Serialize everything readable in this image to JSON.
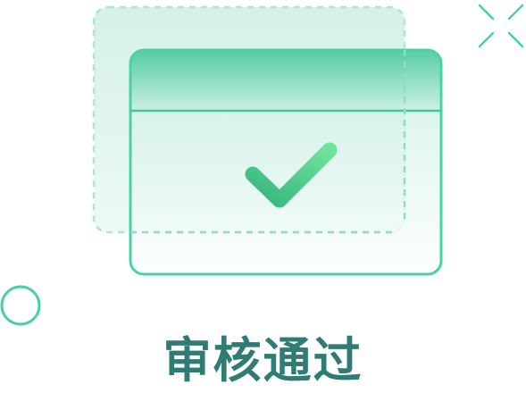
{
  "status": {
    "title": "审核通过",
    "title_color": "#2e7c73"
  },
  "illustration": {
    "icons": [
      "document-window-icon",
      "check-icon",
      "sparkle-icon",
      "circle-decoration-icon"
    ],
    "colors": {
      "accent": "#3fc996",
      "accent_light": "#d6f3ea",
      "back_card_dash": "#aee6d2",
      "check_start": "#36b57c",
      "check_end": "#6ee39b"
    }
  }
}
